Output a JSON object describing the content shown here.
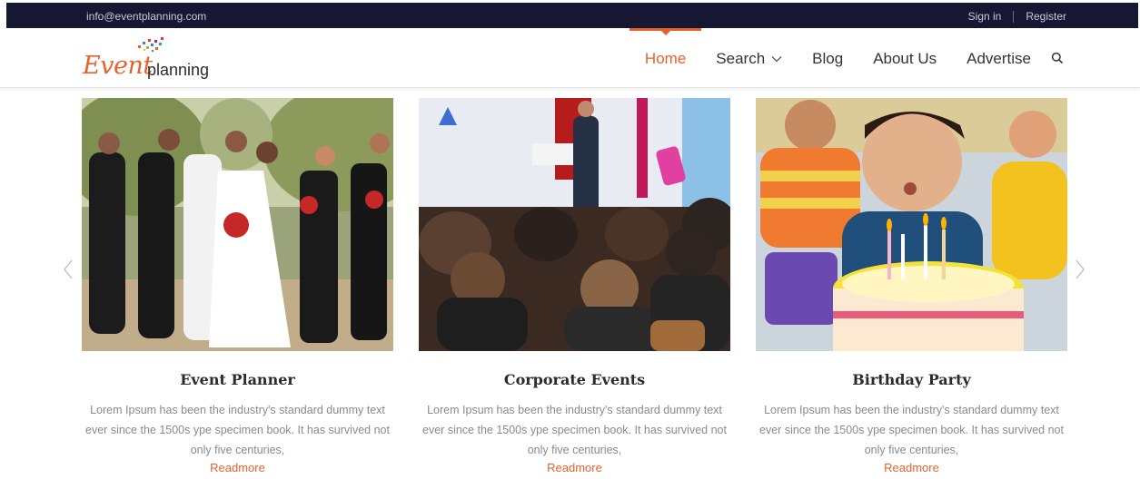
{
  "topbar": {
    "email": "info@eventplanning.com",
    "sign_in": "Sign in",
    "register": "Register"
  },
  "logo": {
    "event": "Event",
    "planning": "planning"
  },
  "nav": {
    "items": [
      {
        "label": "Home",
        "active": true
      },
      {
        "label": "Search",
        "dropdown": true
      },
      {
        "label": "Blog"
      },
      {
        "label": "About Us"
      },
      {
        "label": "Advertise"
      }
    ],
    "search_icon": "search-icon"
  },
  "cards": [
    {
      "title": "Event Planner",
      "desc": "Lorem Ipsum has been the industry's standard dummy text ever since the 1500s ype specimen book. It has survived not only five centuries,",
      "link": "Readmore",
      "image": "wedding-party-photo"
    },
    {
      "title": "Corporate Events",
      "desc": "Lorem Ipsum has been the industry's standard dummy text ever since the 1500s ype specimen book. It has survived not only five centuries,",
      "link": "Readmore",
      "image": "conference-audience-photo"
    },
    {
      "title": "Birthday Party",
      "desc": "Lorem Ipsum has been the industry's standard dummy text ever since the 1500s ype specimen book. It has survived not only five centuries,",
      "link": "Readmore",
      "image": "birthday-cake-photo"
    }
  ],
  "carousel": {
    "prev_icon": "chevron-left-icon",
    "next_icon": "chevron-right-icon"
  },
  "colors": {
    "accent": "#e8612c",
    "topbar_bg": "#161733"
  }
}
